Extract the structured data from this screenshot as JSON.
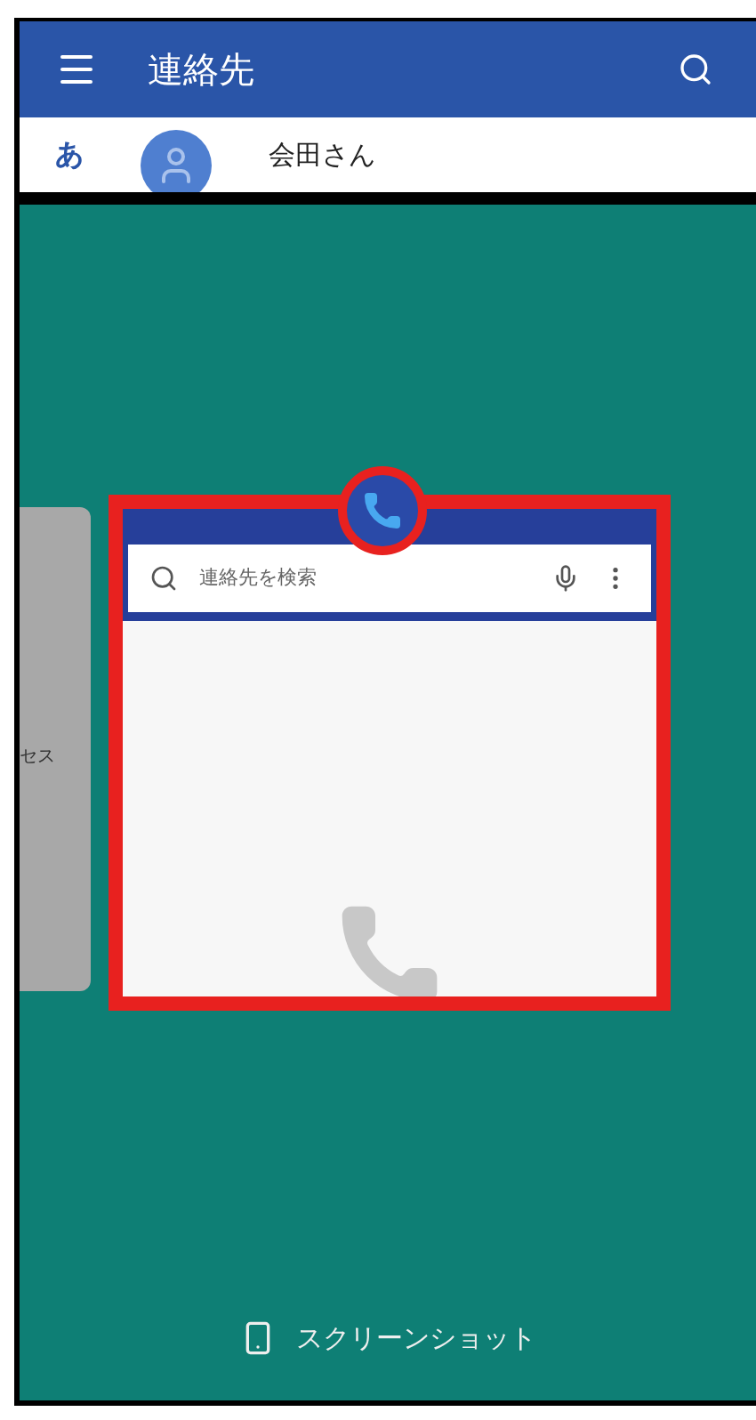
{
  "top_app": {
    "title": "連絡先",
    "contact_row": {
      "index_letter": "あ",
      "name": "会田さん"
    }
  },
  "side_card": {
    "text": "セス"
  },
  "floating_app": {
    "search": {
      "placeholder": "連絡先を検索"
    }
  },
  "bottom_action": {
    "label": "スクリーンショット"
  }
}
